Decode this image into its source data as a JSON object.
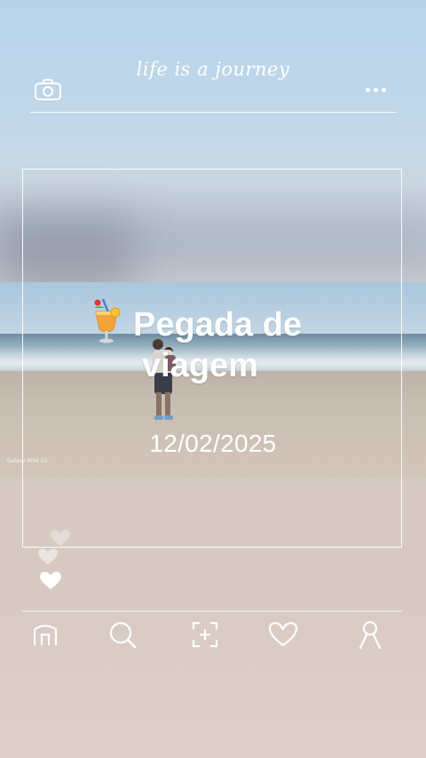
{
  "header": {
    "title": "life is a journey",
    "camera_icon": "camera-icon",
    "more_icon": "more-dots-icon"
  },
  "post": {
    "title_line1": "Pegada de",
    "title_line2": "viagem",
    "date": "12/02/2025",
    "emoji": "tropical-drink-icon",
    "photo_credit": "Galaxy M34 5G"
  },
  "reactions": {
    "icons": [
      "heart-icon",
      "heart-icon",
      "heart-icon"
    ]
  },
  "nav": {
    "items": [
      {
        "name": "home",
        "icon": "home-icon"
      },
      {
        "name": "search",
        "icon": "search-icon"
      },
      {
        "name": "add",
        "icon": "add-icon"
      },
      {
        "name": "likes",
        "icon": "heart-icon"
      },
      {
        "name": "profile",
        "icon": "profile-icon"
      }
    ]
  },
  "colors": {
    "accent": "#ffffff",
    "sky": "#b7d3ea",
    "sand": "#d3c6ba"
  }
}
